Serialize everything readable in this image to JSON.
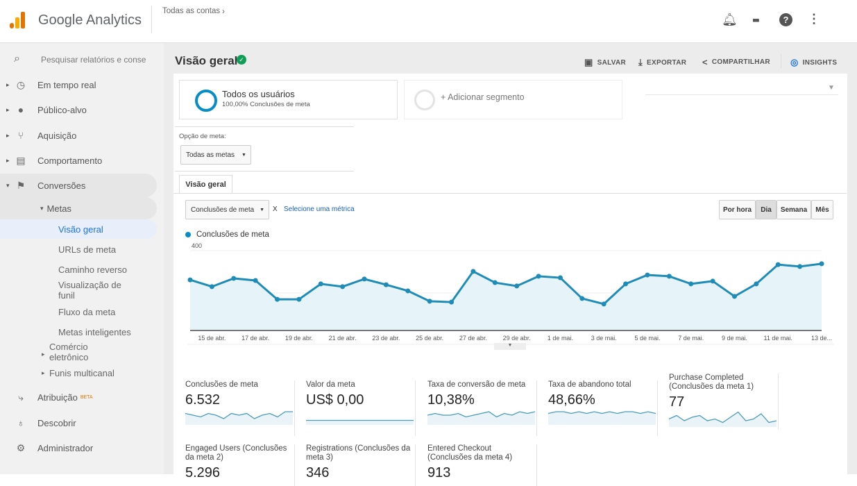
{
  "header": {
    "app_name": "Google Analytics",
    "breadcrumb": "Todas as contas",
    "icons": [
      "bell-icon",
      "apps-icon",
      "help-icon",
      "more-vert-icon"
    ]
  },
  "sidebar": {
    "search_placeholder": "Pesquisar relatórios e conse",
    "items": [
      {
        "label": "Em tempo real",
        "icon": "clock-icon"
      },
      {
        "label": "Público-alvo",
        "icon": "person-icon"
      },
      {
        "label": "Aquisição",
        "icon": "acquisition-icon"
      },
      {
        "label": "Comportamento",
        "icon": "behavior-icon"
      },
      {
        "label": "Conversões",
        "icon": "flag-icon"
      }
    ],
    "metas_label": "Metas",
    "metas_items": [
      "Visão geral",
      "URLs de meta",
      "Caminho reverso",
      "Visualização de funil",
      "Fluxo da meta",
      "Metas inteligentes"
    ],
    "ecommerce": "Comércio eletrônico",
    "multichannel": "Funis multicanal",
    "bottom": [
      {
        "label": "Atribuição",
        "badge": "BETA",
        "icon": "attribution-icon"
      },
      {
        "label": "Descobrir",
        "icon": "lightbulb-icon"
      },
      {
        "label": "Administrador",
        "icon": "gear-icon"
      }
    ]
  },
  "page": {
    "title": "Visão geral",
    "toolbar": {
      "save": "SALVAR",
      "export": "EXPORTAR",
      "share": "COMPARTILHAR",
      "insights": "INSIGHTS"
    }
  },
  "segments": {
    "active_name": "Todos os usuários",
    "active_sub": "100,00% Conclusões de meta",
    "add": "+ Adicionar segmento"
  },
  "goal_option": {
    "label": "Opção de meta:",
    "value": "Todas as metas"
  },
  "tab": "Visão geral",
  "metric_selector": {
    "value": "Conclusões de meta",
    "x": "X",
    "secondary": "Selecione uma métrica"
  },
  "granularity": {
    "options": [
      "Por hora",
      "Dia",
      "Semana",
      "Mês"
    ],
    "active": "Dia"
  },
  "chart_data": {
    "type": "area",
    "series": [
      {
        "name": "Conclusões de meta",
        "color": "#058dc7",
        "values": [
          262,
          230,
          269,
          259,
          170,
          170,
          243,
          230,
          266,
          239,
          210,
          161,
          157,
          302,
          249,
          233,
          279,
          272,
          174,
          148,
          243,
          285,
          279,
          243,
          256,
          184,
          243,
          334,
          325,
          338
        ]
      }
    ],
    "yticks": [
      "400",
      "200"
    ],
    "ylim": [
      0,
      400
    ],
    "xticks": [
      "15 de abr.",
      "17 de abr.",
      "19 de abr.",
      "21 de abr.",
      "23 de abr.",
      "25 de abr.",
      "27 de abr.",
      "29 de abr.",
      "1 de mai.",
      "3 de mai.",
      "5 de mai.",
      "7 de mai.",
      "9 de mai.",
      "11 de mai.",
      "13 de..."
    ],
    "grid": true,
    "legend": "top-left"
  },
  "kpis": [
    {
      "label": "Conclusões de meta",
      "value": "6.532",
      "spark": [
        5,
        4,
        3,
        5,
        4,
        2,
        5,
        4,
        5,
        2,
        4,
        5,
        3,
        6,
        6
      ]
    },
    {
      "label": "Valor da meta",
      "value": "US$ 0,00",
      "spark": [
        1,
        1,
        1,
        1,
        1,
        1,
        1,
        1,
        1,
        1,
        1,
        1,
        1,
        1,
        1
      ]
    },
    {
      "label": "Taxa de conversão de meta",
      "value": "10,38%",
      "spark": [
        4,
        5,
        4,
        4,
        5,
        3,
        4,
        5,
        6,
        3,
        5,
        4,
        6,
        5,
        6
      ]
    },
    {
      "label": "Taxa de abandono total",
      "value": "48,66%",
      "spark": [
        5,
        6,
        6,
        5,
        6,
        5,
        6,
        5,
        6,
        5,
        6,
        6,
        5,
        6,
        5
      ]
    },
    {
      "label": "Purchase Completed (Conclusões da meta 1)",
      "value": "77",
      "spark": [
        3,
        5,
        2,
        4,
        5,
        2,
        3,
        1,
        4,
        7,
        2,
        3,
        6,
        1,
        2
      ]
    },
    {
      "label": "Engaged Users (Conclusões da meta 2)",
      "value": "5.296"
    },
    {
      "label": "Registrations (Conclusões da meta 3)",
      "value": "346"
    },
    {
      "label": "Entered Checkout (Conclusões da meta 4)",
      "value": "913"
    }
  ]
}
